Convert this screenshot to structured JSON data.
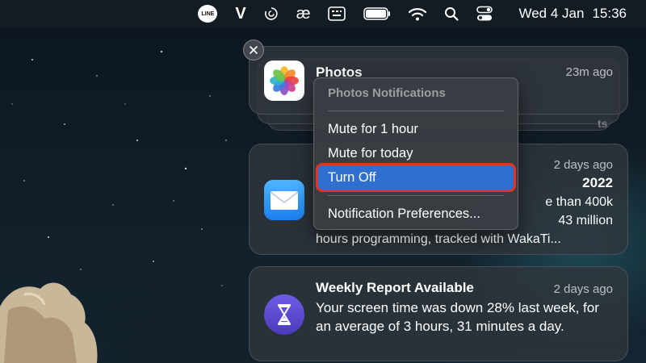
{
  "menubar": {
    "items": [
      {
        "name": "line-icon",
        "label": "LINE"
      },
      {
        "name": "v-icon",
        "label": "V"
      },
      {
        "name": "sync-icon",
        "label": ""
      },
      {
        "name": "ae-icon",
        "label": "æ"
      },
      {
        "name": "keyboard-icon",
        "label": ""
      },
      {
        "name": "battery-icon",
        "label": ""
      },
      {
        "name": "wifi-icon",
        "label": ""
      },
      {
        "name": "search-icon",
        "label": ""
      },
      {
        "name": "control-center-icon",
        "label": ""
      }
    ],
    "date": "Wed 4 Jan",
    "time": "15:36"
  },
  "notifications": {
    "photos": {
      "app": "Photos",
      "time": "23m ago",
      "stub": "ts"
    },
    "mail": {
      "time": "2 days ago",
      "title_fragment": "2022",
      "lines": [
        "e than 400k",
        "43 million",
        "hours programming, tracked with WakaTi..."
      ]
    },
    "screentime": {
      "title": "Weekly Report Available",
      "time": "2 days ago",
      "body": "Your screen time was down 28% last week, for an average of 3 hours, 31 minutes a day."
    }
  },
  "context_menu": {
    "header": "Photos Notifications",
    "items": [
      "Mute for 1 hour",
      "Mute for today",
      "Turn Off",
      "Notification Preferences..."
    ],
    "selected": "Turn Off",
    "highlight_color": "#2e6fcf",
    "outline_color": "#e0362a"
  }
}
